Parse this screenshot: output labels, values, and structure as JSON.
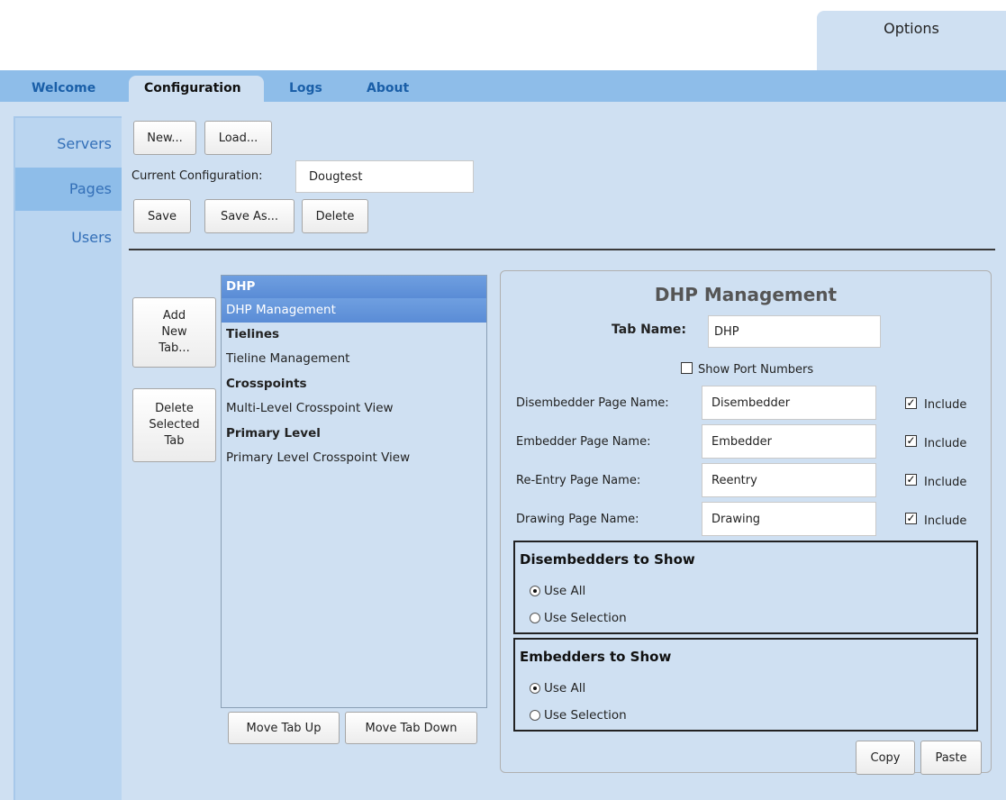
{
  "options_tab": "Options",
  "top_tabs": [
    {
      "label": "Welcome"
    },
    {
      "label": "Configuration",
      "active": true
    },
    {
      "label": "Logs"
    },
    {
      "label": "About"
    }
  ],
  "sidebar": {
    "items": [
      {
        "label": "Servers"
      },
      {
        "label": "Pages",
        "active": true
      },
      {
        "label": "Users"
      }
    ]
  },
  "config": {
    "new_label": "New...",
    "load_label": "Load...",
    "current_label": "Current Configuration:",
    "current_value": "Dougtest",
    "save_label": "Save",
    "save_as_label": "Save As...",
    "delete_label": "Delete"
  },
  "tabs_panel": {
    "add_new_tab_lines": [
      "Add",
      "New",
      "Tab..."
    ],
    "delete_selected_lines": [
      "Delete",
      "Selected",
      "Tab"
    ],
    "move_up_label": "Move Tab Up",
    "move_down_label": "Move Tab Down",
    "list": [
      {
        "text": "DHP",
        "group": true,
        "selected": true
      },
      {
        "text": "DHP Management",
        "selected": true
      },
      {
        "text": "Tielines",
        "group": true
      },
      {
        "text": "Tieline Management"
      },
      {
        "text": "Crosspoints",
        "group": true
      },
      {
        "text": "Multi-Level Crosspoint View"
      },
      {
        "text": "Primary Level",
        "group": true
      },
      {
        "text": "Primary Level Crosspoint View"
      }
    ]
  },
  "detail": {
    "title": "DHP Management",
    "tab_name_label": "Tab Name:",
    "tab_name_value": "DHP",
    "show_port_numbers_label": "Show Port Numbers",
    "show_port_numbers_checked": false,
    "pages": [
      {
        "label": "Disembedder Page Name:",
        "value": "Disembedder",
        "include_label": "Include",
        "include_checked": true
      },
      {
        "label": "Embedder Page Name:",
        "value": "Embedder",
        "include_label": "Include",
        "include_checked": true
      },
      {
        "label": "Re-Entry Page Name:",
        "value": "Reentry",
        "include_label": "Include",
        "include_checked": true
      },
      {
        "label": "Drawing Page Name:",
        "value": "Drawing",
        "include_label": "Include",
        "include_checked": true
      }
    ],
    "disembedders_group": {
      "title": "Disembedders to Show",
      "use_all_label": "Use All",
      "use_selection_label": "Use Selection",
      "selected": "Use All"
    },
    "embedders_group": {
      "title": "Embedders to Show",
      "use_all_label": "Use All",
      "use_selection_label": "Use Selection",
      "selected": "Use All"
    },
    "copy_label": "Copy",
    "paste_label": "Paste"
  }
}
